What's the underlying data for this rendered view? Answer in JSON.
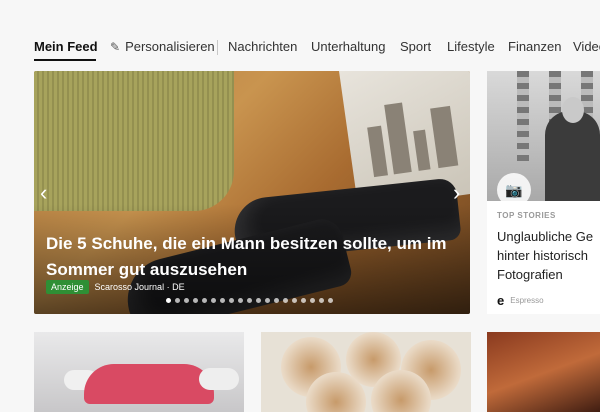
{
  "nav": {
    "items": [
      {
        "label": "Mein Feed",
        "active": true
      },
      {
        "label": "Personalisieren",
        "icon": "pencil-icon"
      },
      {
        "label": "Nachrichten"
      },
      {
        "label": "Unterhaltung"
      },
      {
        "label": "Sport"
      },
      {
        "label": "Lifestyle"
      },
      {
        "label": "Finanzen"
      },
      {
        "label": "Videos"
      }
    ]
  },
  "hero": {
    "title": "Die 5 Schuhe, die ein Mann besitzen sollte, um im Sommer gut auszusehen",
    "badge": "Anzeige",
    "source": "Scarosso Journal · DE",
    "prev_icon": "chevron-left-icon",
    "next_icon": "chevron-right-icon",
    "prev_glyph": "‹",
    "next_glyph": "›",
    "slide_count": 19,
    "active_slide": 0
  },
  "side_card": {
    "category": "TOP STORIES",
    "title_lines": [
      "Unglaubliche Ge",
      "hinter historisch",
      "Fotografien"
    ],
    "publisher_logo": "e",
    "publisher": "Espresso",
    "camera_icon": "camera-icon"
  },
  "colors": {
    "ad_badge": "#2f8f35",
    "nav_active": "#111111"
  }
}
